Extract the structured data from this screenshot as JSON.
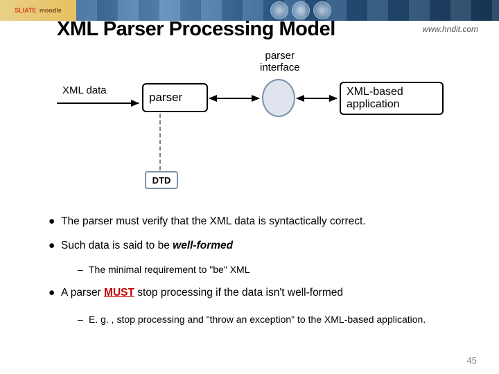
{
  "banner": {
    "logo1": "SLIATE",
    "logo2": "moodle"
  },
  "url_hint": "www.hndit.com",
  "title": "XML Parser Processing Model",
  "diagram": {
    "iface_label_l1": "parser",
    "iface_label_l2": "interface",
    "xml_data": "XML data",
    "parser": "parser",
    "app_l1": "XML-based",
    "app_l2": "application",
    "dtd": "DTD"
  },
  "bullets": {
    "b1": "The parser must verify that the XML data is syntactically correct.",
    "b2_pre": "Such data is said to be ",
    "b2_wf": "well-formed",
    "b2_sub": "The minimal requirement to \"be\" XML",
    "b3_pre": "A parser  ",
    "b3_must": "MUST",
    "b3_post": "  stop processing if the data isn't well-formed",
    "b3_sub": "E. g. , stop processing and \"throw an exception\" to the XML-based application."
  },
  "page_number": "45"
}
